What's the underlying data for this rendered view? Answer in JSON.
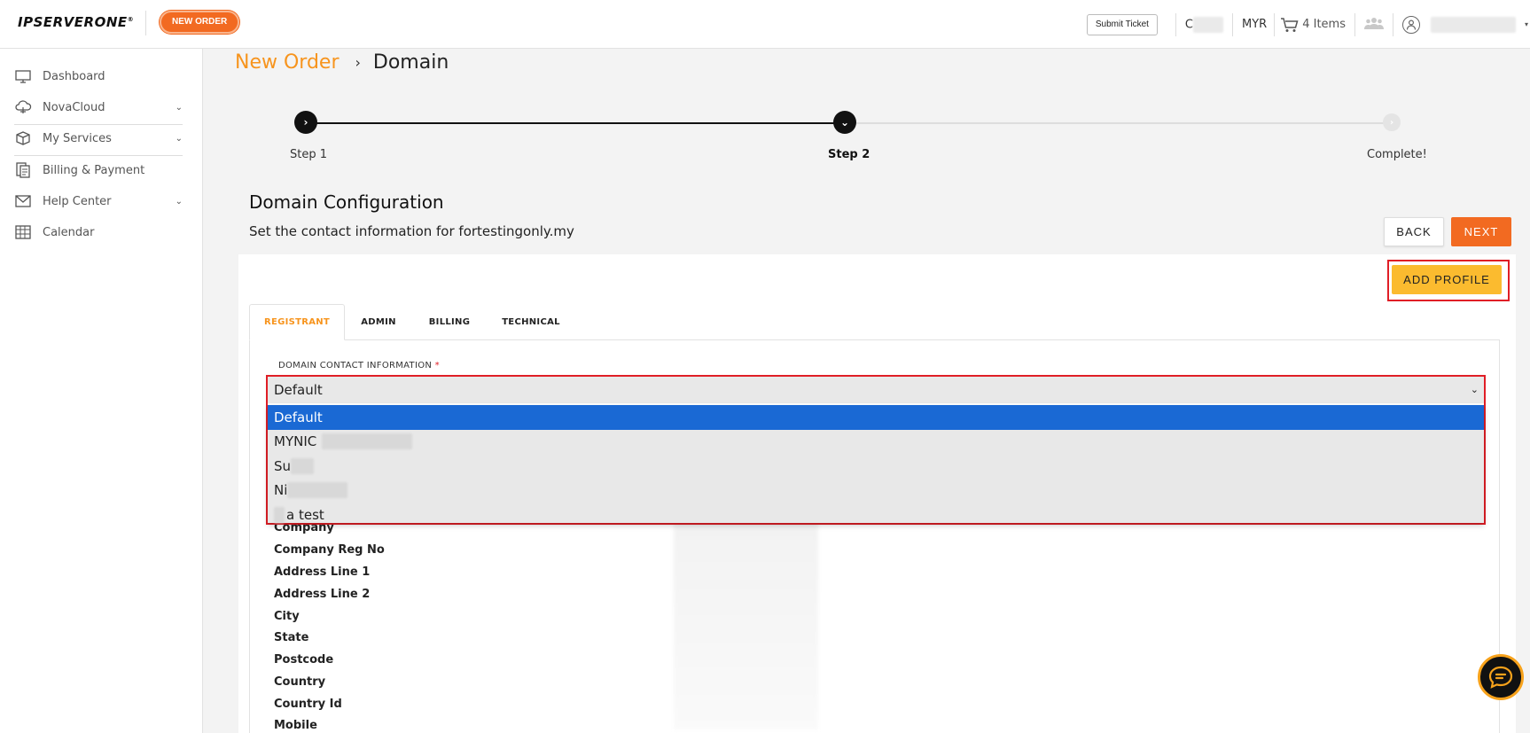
{
  "header": {
    "logo_text": "IPSERVERONE",
    "logo_mark": "®",
    "new_order_label": "NEW ORDER",
    "submit_ticket_label": "Submit Ticket",
    "credit_prefix": "C",
    "currency": "MYR",
    "cart_label": "4 Items"
  },
  "sidebar": {
    "items": [
      {
        "label": "Dashboard",
        "icon": "monitor-icon",
        "expandable": false
      },
      {
        "label": "NovaCloud",
        "icon": "cloud-icon",
        "expandable": true
      },
      {
        "label": "My Services",
        "icon": "box-icon",
        "expandable": true
      },
      {
        "label": "Billing & Payment",
        "icon": "invoice-icon",
        "expandable": false
      },
      {
        "label": "Help Center",
        "icon": "mail-icon",
        "expandable": true
      },
      {
        "label": "Calendar",
        "icon": "calendar-icon",
        "expandable": false
      }
    ]
  },
  "breadcrumb": {
    "parent": "New Order",
    "separator": "›",
    "current": "Domain"
  },
  "stepper": {
    "steps": [
      {
        "label": "Step 1",
        "state": "done"
      },
      {
        "label": "Step 2",
        "state": "current"
      },
      {
        "label": "Complete!",
        "state": "todo"
      }
    ]
  },
  "config": {
    "title": "Domain Configuration",
    "subtitle": "Set the contact information for fortestingonly.my",
    "back_label": "BACK",
    "next_label": "NEXT",
    "add_profile_label": "ADD PROFILE"
  },
  "tabs": [
    "REGISTRANT",
    "ADMIN",
    "BILLING",
    "TECHNICAL"
  ],
  "field": {
    "label": "DOMAIN CONTACT INFORMATION",
    "required_mark": "*",
    "selected_value": "Default",
    "options": [
      "Default",
      "MYNIC",
      "Su",
      "Ni",
      "a test"
    ]
  },
  "info_labels": [
    "Company",
    "Company Reg No",
    "Address Line 1",
    "Address Line 2",
    "City",
    "State",
    "Postcode",
    "Country",
    "Country Id",
    "Mobile"
  ],
  "colors": {
    "accent_orange": "#f26a21",
    "link_orange": "#f7941d",
    "add_profile_yellow": "#fbbb2f",
    "highlight_red": "#e01e26",
    "selected_blue": "#1a69d4"
  }
}
